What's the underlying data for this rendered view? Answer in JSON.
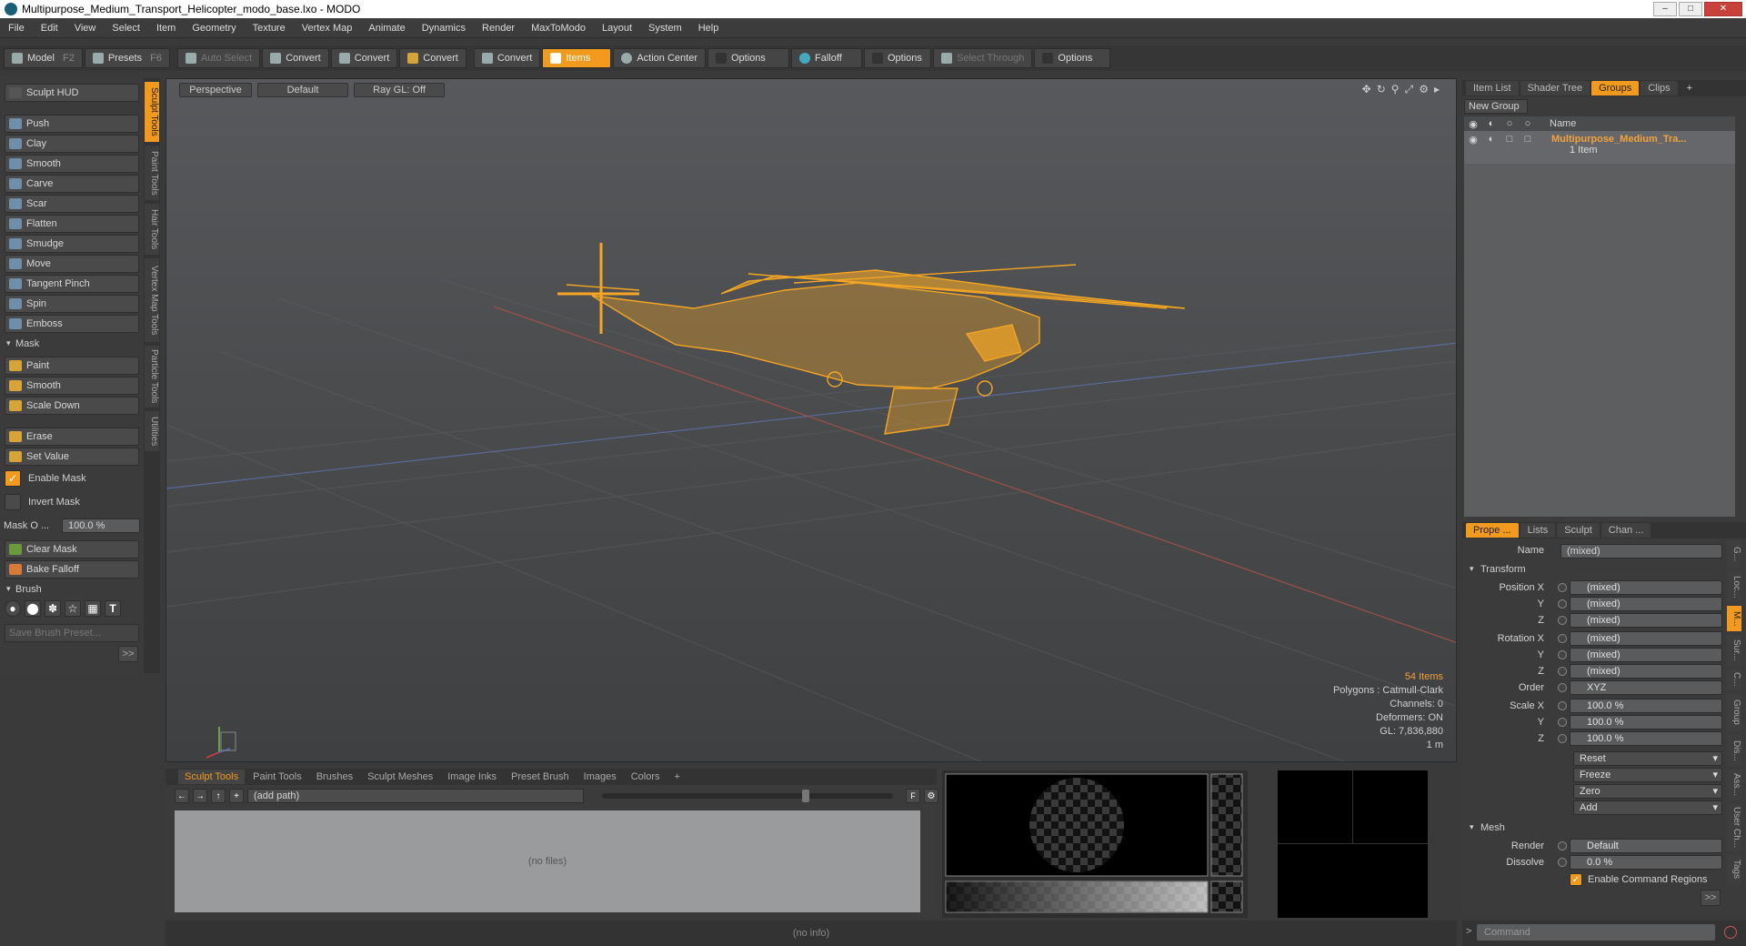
{
  "window": {
    "title": "Multipurpose_Medium_Transport_Helicopter_modo_base.lxo - MODO"
  },
  "menu": [
    "File",
    "Edit",
    "View",
    "Select",
    "Item",
    "Geometry",
    "Texture",
    "Vertex Map",
    "Animate",
    "Dynamics",
    "Render",
    "MaxToModo",
    "Layout",
    "System",
    "Help"
  ],
  "toolbar": {
    "model": "Model",
    "model_key": "F2",
    "presets": "Presets",
    "presets_key": "F6",
    "auto_select": "Auto Select",
    "convert1": "Convert",
    "convert2": "Convert",
    "convert3": "Convert",
    "convert4": "Convert",
    "items": "Items",
    "action_center": "Action Center",
    "options1": "Options",
    "falloff": "Falloff",
    "options2": "Options",
    "select_through": "Select Through",
    "options3": "Options"
  },
  "left": {
    "sculpt_hud": "Sculpt HUD",
    "tools": [
      "Push",
      "Clay",
      "Smooth",
      "Carve",
      "Scar",
      "Flatten",
      "Smudge",
      "Move",
      "Tangent Pinch",
      "Spin",
      "Emboss"
    ],
    "mask_section": "Mask",
    "mask_tools": [
      "Paint",
      "Smooth",
      "Scale Down"
    ],
    "erase": "Erase",
    "set_value": "Set Value",
    "enable_mask": "Enable Mask",
    "invert_mask": "Invert Mask",
    "mask_opacity_label": "Mask O ...",
    "mask_opacity_value": "100.0 %",
    "clear_mask": "Clear Mask",
    "bake_falloff": "Bake Falloff",
    "brush_section": "Brush",
    "save_brush_preset": "Save Brush Preset...",
    "more": ">>"
  },
  "vtabs": [
    "Sculpt Tools",
    "Paint Tools",
    "Hair Tools",
    "Vertex Map Tools",
    "Particle Tools",
    "Utilities"
  ],
  "viewport": {
    "perspective": "Perspective",
    "default": "Default",
    "raygl": "Ray GL: Off",
    "items_count": "54 Items",
    "polygons": "Polygons : Catmull-Clark",
    "channels": "Channels: 0",
    "deformers": "Deformers: ON",
    "gl": "GL: 7,836,880",
    "scale": "1 m"
  },
  "right_top": {
    "tabs": [
      "Item List",
      "Shader Tree",
      "Groups",
      "Clips"
    ],
    "new_group": "New Group",
    "col_name": "Name",
    "group_name": "Multipurpose_Medium_Tra...",
    "group_sub": "1 Item"
  },
  "properties": {
    "tabs": [
      "Prope ...",
      "Lists",
      "Sculpt",
      "Chan ..."
    ],
    "name_label": "Name",
    "name_value": "(mixed)",
    "transform": "Transform",
    "position_x": "Position X",
    "y": "Y",
    "z": "Z",
    "rotation_x": "Rotation X",
    "mixed": "(mixed)",
    "order_label": "Order",
    "order_value": "XYZ",
    "scale_x": "Scale X",
    "scale_value": "100.0 %",
    "reset": "Reset",
    "freeze": "Freeze",
    "zero": "Zero",
    "add": "Add",
    "mesh": "Mesh",
    "render_label": "Render",
    "render_value": "Default",
    "dissolve_label": "Dissolve",
    "dissolve_value": "0.0 %",
    "enable_cmd_regions": "Enable Command Regions",
    "more": ">>"
  },
  "right_vtabs": [
    "G...",
    "Loc...",
    "M...",
    "Sur...",
    "C...",
    "Group",
    "Dis...",
    "Ass...",
    "User Ch...",
    "Tags"
  ],
  "bottom": {
    "tabs": [
      "Sculpt Tools",
      "Paint Tools",
      "Brushes",
      "Sculpt Meshes",
      "Image Inks",
      "Preset Brush",
      "Images",
      "Colors",
      "+"
    ],
    "path": "(add path)",
    "nofiles": "(no files)"
  },
  "status": {
    "info": "(no info)",
    "command": "Command"
  },
  "colors": {
    "accent": "#f29a1e",
    "wire": "#f5a623"
  }
}
